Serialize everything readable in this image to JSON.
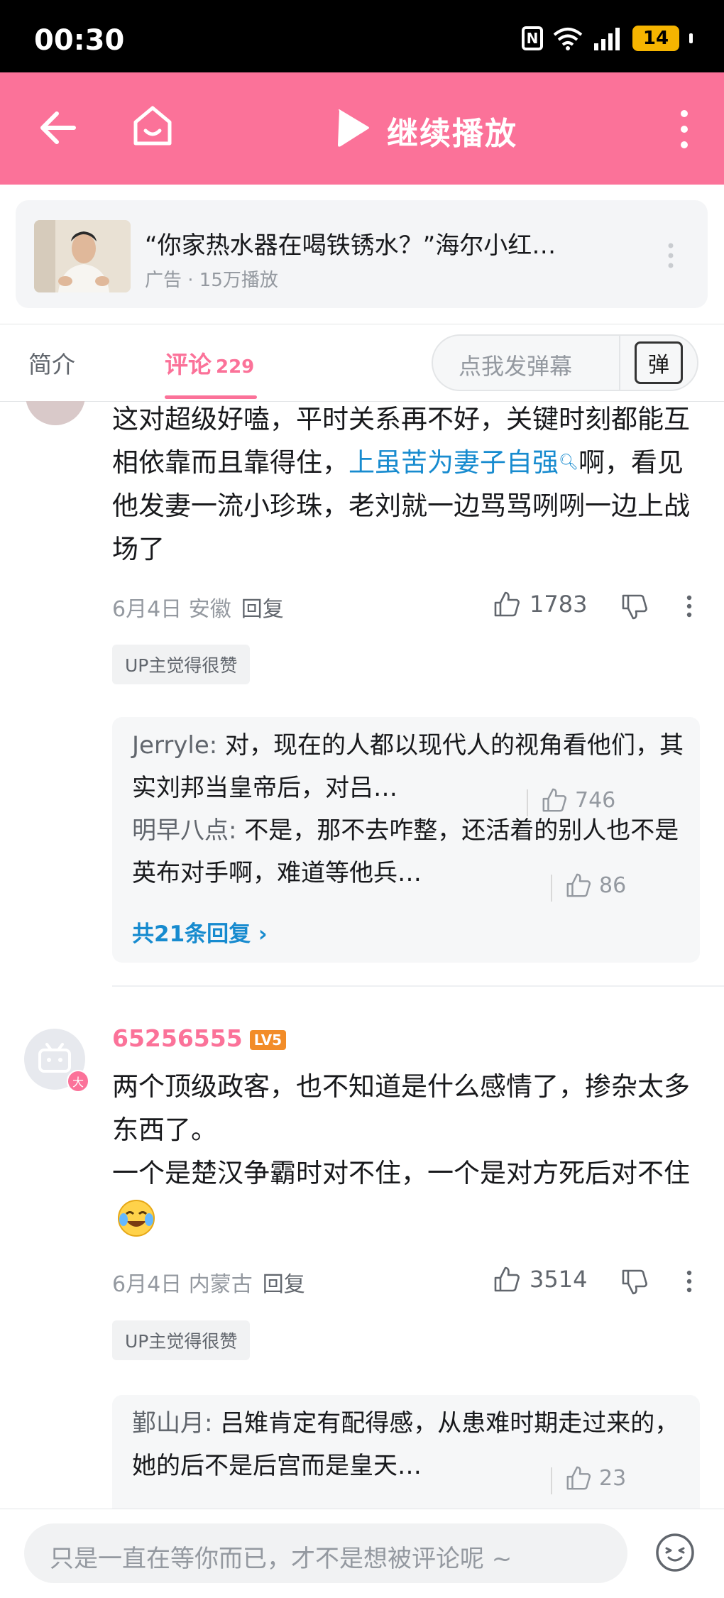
{
  "status_bar": {
    "time": "00:30",
    "battery": "14"
  },
  "top_bar": {
    "continue_label": "继续播放"
  },
  "ad": {
    "title": "“你家热水器在喝铁锈水？”海尔小红…",
    "meta": "广告 · 15万播放"
  },
  "tabs": {
    "intro": "简介",
    "comments": "评论",
    "comment_count": "229",
    "danmaku_placeholder": "点我发弹幕",
    "danmaku_icon_char": "弹"
  },
  "comments": [
    {
      "text_part1": "这对超级好嗑，平时关系再不好，关键时刻都能互相依靠而且靠得住，",
      "link_text": "上虽苦为妻子自强",
      "text_part2": "啊，看见他发妻一流小珍珠，老刘就一边骂骂咧咧一边上战场了",
      "date_location": "6月4日 安徽",
      "reply_label": "回复",
      "likes": "1783",
      "badge": "UP主觉得很赞",
      "replies": [
        {
          "user": "Jerryle:",
          "text": " 对，现在的人都以现代人的视角看他们，其实刘邦当皇帝后，对吕…",
          "likes": "746"
        },
        {
          "user": "明早八点:",
          "text": " 不是，那不去咋整，还活着的别人也不是英布对手啊，难道等他兵…",
          "likes": "86"
        }
      ],
      "more_replies": "共21条回复 ›"
    },
    {
      "username": "65256555",
      "level": "LV5",
      "avatar_badge": "大",
      "line1": "两个顶级政客，也不知道是什么感情了，掺杂太多东西了。",
      "line2": "一个是楚汉争霸时对不住，一个是对方死后对不住",
      "date_location": "6月4日 内蒙古",
      "reply_label": "回复",
      "likes": "3514",
      "badge": "UP主觉得很赞",
      "replies": [
        {
          "user": "鄞山月:",
          "text": " 吕雉肯定有配得感，从患难时期走过来的，她的后不是后宫而是皇天…",
          "likes": "23"
        }
      ]
    }
  ],
  "bottom_bar": {
    "input_placeholder": "只是一直在等你而已，才不是想被评论呢 ~"
  }
}
